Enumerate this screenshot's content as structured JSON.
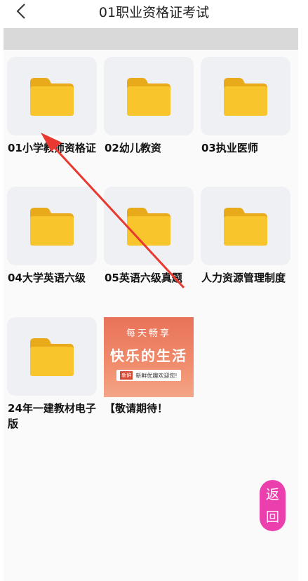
{
  "header": {
    "title": "01职业资格证考试",
    "back_icon": "chevron-left-icon"
  },
  "grid": {
    "items": [
      {
        "label": "01小学教师资格证",
        "icon": "folder-icon"
      },
      {
        "label": "02幼儿教资",
        "icon": "folder-icon"
      },
      {
        "label": "03执业医师",
        "icon": "folder-icon"
      },
      {
        "label": "04大学英语六级",
        "icon": "folder-icon"
      },
      {
        "label": "05英语六级真题",
        "icon": "folder-icon"
      },
      {
        "label": "人力资源管理制度",
        "icon": "folder-icon"
      },
      {
        "label": "24年一建教材电子版",
        "icon": "folder-icon"
      },
      {
        "label": "【敬请期待！",
        "thumbnail": {
          "line1": "每天畅享",
          "line2": "快乐的生活",
          "tag": "新鲜",
          "subtitle": "新鲜优趣欢迎您!"
        }
      }
    ]
  },
  "fab": {
    "line1": "返",
    "line2": "回"
  },
  "colors": {
    "folder": "#f8c52c",
    "fab": "#ec3fae",
    "annotation_arrow": "#e8382f"
  }
}
